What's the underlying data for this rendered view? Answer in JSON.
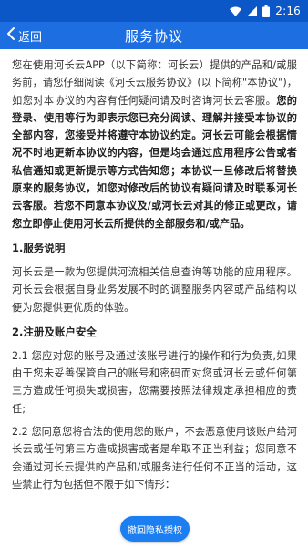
{
  "status_bar": {
    "time": "2:16"
  },
  "nav": {
    "back_label": "返回",
    "title": "服务协议"
  },
  "document": {
    "intro_normal": "您在使用河长云APP（以下简称：河长云）提供的产品和/或服务前，请您仔细阅读《河长云服务协议》(以下简称\"本协议\")，如您对本协议的内容有任何疑问请及时咨询河长云客服。",
    "intro_bold": "您的登录、使用等行为即表示您已充分阅读、理解并接受本协议的全部内容，您接受并将遵守本协议约定。河长云可能会根据情况不时地更新本协议的内容，但是均会通过应用程序公告或者私信通知或更新提示等方式告知您；本协议一旦修改后将替换原来的服务协议，如您对修改后的协议有疑问请及时联系河长云客服。若您不同意本协议及/或河长云对其的修正或更改，请您立即停止使用河长云所提供的全部服务和/或产品。",
    "section1_title": "1.服务说明",
    "section1_text": "河长云是一款为您提供河流相关信息查询等功能的应用程序。河长云会根据自身业务发展不时的调整服务内容或产品结构以便为您提供更优质的体验。",
    "section2_title": "2.注册及账户安全",
    "section2_1": "2.1 您应对您的账号及通过该账号进行的操作和行为负责,如果由于您未妥善保管自己的账号和密码而对您或河长云或任何第三方造成任何损失或损害，您需要按照法律规定承担相应的责任;",
    "section2_2": "2.2 您同意您将合法的使用您的账户，不会恶意使用该账户给河长云或任何第三方造成损害或者是牟取不正当利益；您同意不会通过河长云提供的产品和/或服务进行任何不正当的活动，这些禁止行为包括但不限于如下情形："
  },
  "actions": {
    "revoke_label": "撤回隐私授权"
  },
  "colors": {
    "status_bar": "#0b57c8",
    "title_bar": "#1d6ee0",
    "button": "#1b7ff2"
  }
}
